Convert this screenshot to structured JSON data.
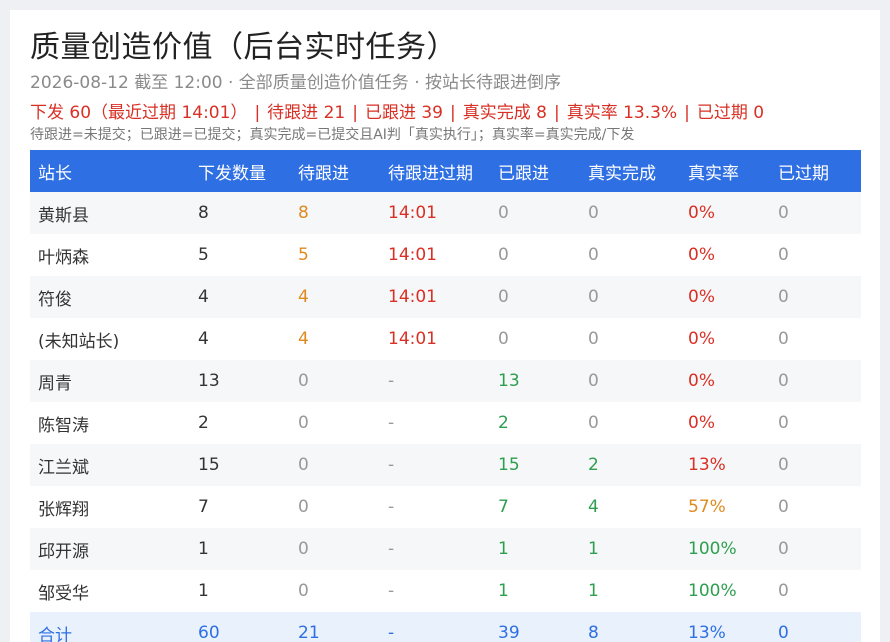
{
  "header": {
    "title": "质量创造价值（后台实时任务）",
    "meta": "2026-08-12 截至 12:00 · 全部质量创造价值任务 · 按站长待跟进倒序",
    "stats": [
      "下发 60（最近过期 14:01）",
      "待跟进 21",
      "已跟进 39",
      "真实完成 8",
      "真实率 13.3%",
      "已过期 0"
    ],
    "stats_separator": "|",
    "legend": "待跟进=未提交；已跟进=已提交；真实完成=已提交且AI判「真实执行」；真实率=真实完成/下发"
  },
  "table": {
    "columns": [
      "站长",
      "下发数量",
      "待跟进",
      "待跟进过期",
      "已跟进",
      "真实完成",
      "真实率",
      "已过期"
    ],
    "rows": [
      {
        "name": "黄斯县",
        "issued": "8",
        "pending": "8",
        "pending_expiry": "14:01",
        "followed": "0",
        "completed": "0",
        "rate": "0%",
        "expired": "0"
      },
      {
        "name": "叶炳森",
        "issued": "5",
        "pending": "5",
        "pending_expiry": "14:01",
        "followed": "0",
        "completed": "0",
        "rate": "0%",
        "expired": "0"
      },
      {
        "name": "符俊",
        "issued": "4",
        "pending": "4",
        "pending_expiry": "14:01",
        "followed": "0",
        "completed": "0",
        "rate": "0%",
        "expired": "0"
      },
      {
        "name": "(未知站长)",
        "issued": "4",
        "pending": "4",
        "pending_expiry": "14:01",
        "followed": "0",
        "completed": "0",
        "rate": "0%",
        "expired": "0"
      },
      {
        "name": "周青",
        "issued": "13",
        "pending": "0",
        "pending_expiry": "-",
        "followed": "13",
        "completed": "0",
        "rate": "0%",
        "expired": "0"
      },
      {
        "name": "陈智涛",
        "issued": "2",
        "pending": "0",
        "pending_expiry": "-",
        "followed": "2",
        "completed": "0",
        "rate": "0%",
        "expired": "0"
      },
      {
        "name": "江兰斌",
        "issued": "15",
        "pending": "0",
        "pending_expiry": "-",
        "followed": "15",
        "completed": "2",
        "rate": "13%",
        "expired": "0"
      },
      {
        "name": "张辉翔",
        "issued": "7",
        "pending": "0",
        "pending_expiry": "-",
        "followed": "7",
        "completed": "4",
        "rate": "57%",
        "expired": "0"
      },
      {
        "name": "邱开源",
        "issued": "1",
        "pending": "0",
        "pending_expiry": "-",
        "followed": "1",
        "completed": "1",
        "rate": "100%",
        "expired": "0"
      },
      {
        "name": "邹受华",
        "issued": "1",
        "pending": "0",
        "pending_expiry": "-",
        "followed": "1",
        "completed": "1",
        "rate": "100%",
        "expired": "0"
      }
    ],
    "total": {
      "name": "合计",
      "issued": "60",
      "pending": "21",
      "pending_expiry": "-",
      "followed": "39",
      "completed": "8",
      "rate": "13%",
      "expired": "0"
    }
  },
  "colors": {
    "header_bg": "#2f6fe4",
    "alert_red": "#d93025",
    "pending_orange": "#e08a1e",
    "success_green": "#2e9e4f",
    "muted_gray": "#999999",
    "total_row_bg": "#e8f1fc"
  }
}
